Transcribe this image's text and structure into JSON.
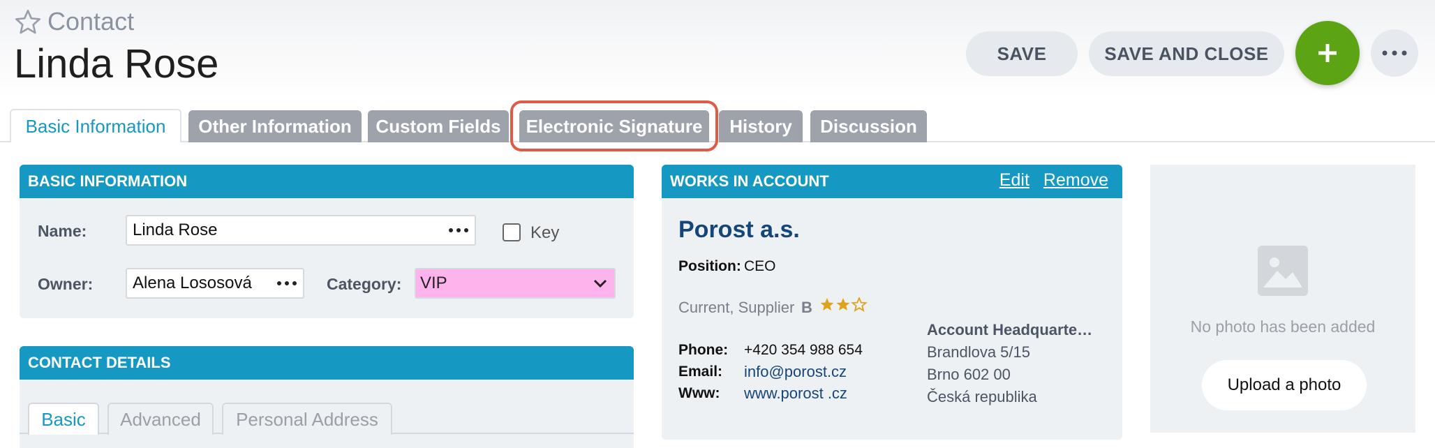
{
  "header": {
    "record_type": "Contact",
    "title": "Linda Rose",
    "save_label": "SAVE",
    "save_close_label": "SAVE AND CLOSE"
  },
  "tabs": [
    {
      "label": "Basic Information",
      "active": true
    },
    {
      "label": "Other Information"
    },
    {
      "label": "Custom Fields"
    },
    {
      "label": "Electronic Signature"
    },
    {
      "label": "History"
    },
    {
      "label": "Discussion"
    }
  ],
  "basic_info": {
    "heading": "BASIC INFORMATION",
    "name_label": "Name:",
    "name_value": "Linda Rose",
    "key_label": "Key",
    "owner_label": "Owner:",
    "owner_value": "Alena Lososová",
    "category_label": "Category:",
    "category_value": "VIP"
  },
  "contact_details": {
    "heading": "CONTACT DETAILS",
    "tabs": [
      "Basic",
      "Advanced",
      "Personal Address"
    ]
  },
  "account": {
    "heading": "WORKS IN ACCOUNT",
    "edit_label": "Edit",
    "remove_label": "Remove",
    "name": "Porost a.s.",
    "position_label": "Position:",
    "position_value": "CEO",
    "relation": "Current, Supplier",
    "grade": "B",
    "rating": 2,
    "rating_max": 3,
    "phone_label": "Phone:",
    "phone_value": "+420 354 988 654",
    "email_label": "Email:",
    "email_value": "info@porost.cz",
    "www_label": "Www:",
    "www_value": "www.porost .cz",
    "address_heading": "Account Headquarte…",
    "address_lines": [
      "Brandlova 5/15",
      "Brno 602 00",
      "Česká republika"
    ]
  },
  "photo": {
    "empty_text": "No photo has been added",
    "upload_label": "Upload a photo"
  },
  "colors": {
    "accent": "#1599c3",
    "add_button": "#5ca413",
    "category_bg": "#ffb3ec",
    "highlight": "#e15a45",
    "star": "#e0a21a"
  }
}
